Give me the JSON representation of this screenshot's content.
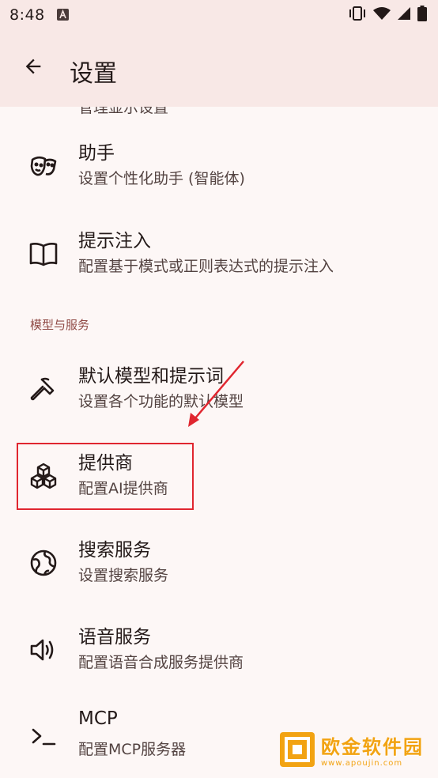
{
  "status_bar": {
    "time": "8:48",
    "notification_icon": "font-a-icon",
    "vibrate_icon": "vibrate-icon",
    "wifi_icon": "wifi-icon",
    "signal_icon": "signal-icon",
    "battery_icon": "battery-icon"
  },
  "app_bar": {
    "back_icon": "arrow-back-icon",
    "title": "设置"
  },
  "settings": {
    "cut_subtitle": "管理显示设置",
    "items": [
      {
        "title": "助手",
        "subtitle": "设置个性化助手 (智能体)",
        "icon": "theater-masks-icon"
      },
      {
        "title": "提示注入",
        "subtitle": "配置基于模式或正则表达式的提示注入",
        "icon": "book-icon"
      },
      {
        "title": "默认模型和提示词",
        "subtitle": "设置各个功能的默认模型",
        "icon": "hammer-icon"
      },
      {
        "title": "提供商",
        "subtitle": "配置AI提供商",
        "icon": "boxes-icon"
      },
      {
        "title": "搜索服务",
        "subtitle": "设置搜索服务",
        "icon": "globe-icon"
      },
      {
        "title": "语音服务",
        "subtitle": "配置语音合成服务提供商",
        "icon": "speaker-icon"
      },
      {
        "title": "MCP",
        "subtitle": "配置MCP服务器",
        "icon": "terminal-icon"
      }
    ],
    "section_header": "模型与服务"
  },
  "annotation": {
    "color": "#e0262f"
  },
  "watermark": {
    "title": "欧金软件园",
    "url": "www.apoujin.com",
    "color": "#f2a312"
  },
  "colors": {
    "background": "#fdf7f6",
    "app_bar": "#f8e8e6",
    "section_header": "#904a45",
    "text_primary": "#231918",
    "text_secondary": "#534341"
  }
}
